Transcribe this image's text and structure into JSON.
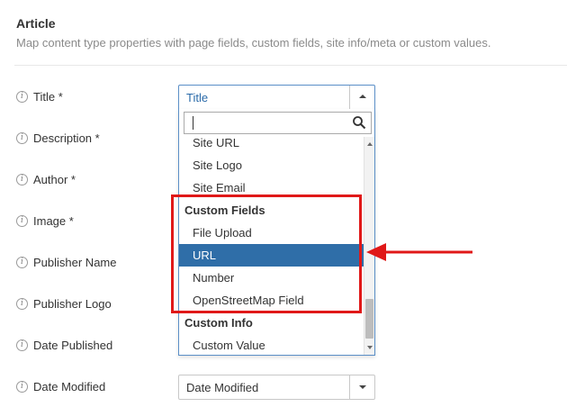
{
  "section": {
    "title": "Article",
    "description": "Map content type properties with page fields, custom fields, site info/meta or custom values."
  },
  "fields": [
    {
      "label": "Title *",
      "info_icon": "i"
    },
    {
      "label": "Description *",
      "info_icon": "i"
    },
    {
      "label": "Author *",
      "info_icon": "i"
    },
    {
      "label": "Image *",
      "info_icon": "i"
    },
    {
      "label": "Publisher Name",
      "info_icon": "i"
    },
    {
      "label": "Publisher Logo",
      "info_icon": "i"
    },
    {
      "label": "Date Published",
      "info_icon": "i"
    },
    {
      "label": "Date Modified",
      "info_icon": "i"
    }
  ],
  "title_select": {
    "value": "Title",
    "state": "open",
    "toggle_icon": "caret-up-icon"
  },
  "date_modified_select": {
    "value": "Date Modified",
    "toggle_icon": "caret-down-icon"
  },
  "dropdown": {
    "search_value": "",
    "search_icon": "search-icon",
    "items": [
      {
        "type": "option",
        "label": "Site URL"
      },
      {
        "type": "option",
        "label": "Site Logo"
      },
      {
        "type": "option",
        "label": "Site Email"
      },
      {
        "type": "group",
        "label": "Custom Fields"
      },
      {
        "type": "option",
        "label": "File Upload"
      },
      {
        "type": "option",
        "label": "URL",
        "highlighted": true
      },
      {
        "type": "option",
        "label": "Number"
      },
      {
        "type": "option",
        "label": "OpenStreetMap Field"
      },
      {
        "type": "group",
        "label": "Custom Info"
      },
      {
        "type": "option",
        "label": "Custom Value"
      }
    ],
    "scroll_position": 0.95
  },
  "annotation": {
    "color": "#e01818",
    "arrow_icon": "arrow-left-icon"
  },
  "colors": {
    "highlight": "#2f6ea8",
    "focus_border": "#5b8fc7",
    "annotation": "#e01818"
  }
}
